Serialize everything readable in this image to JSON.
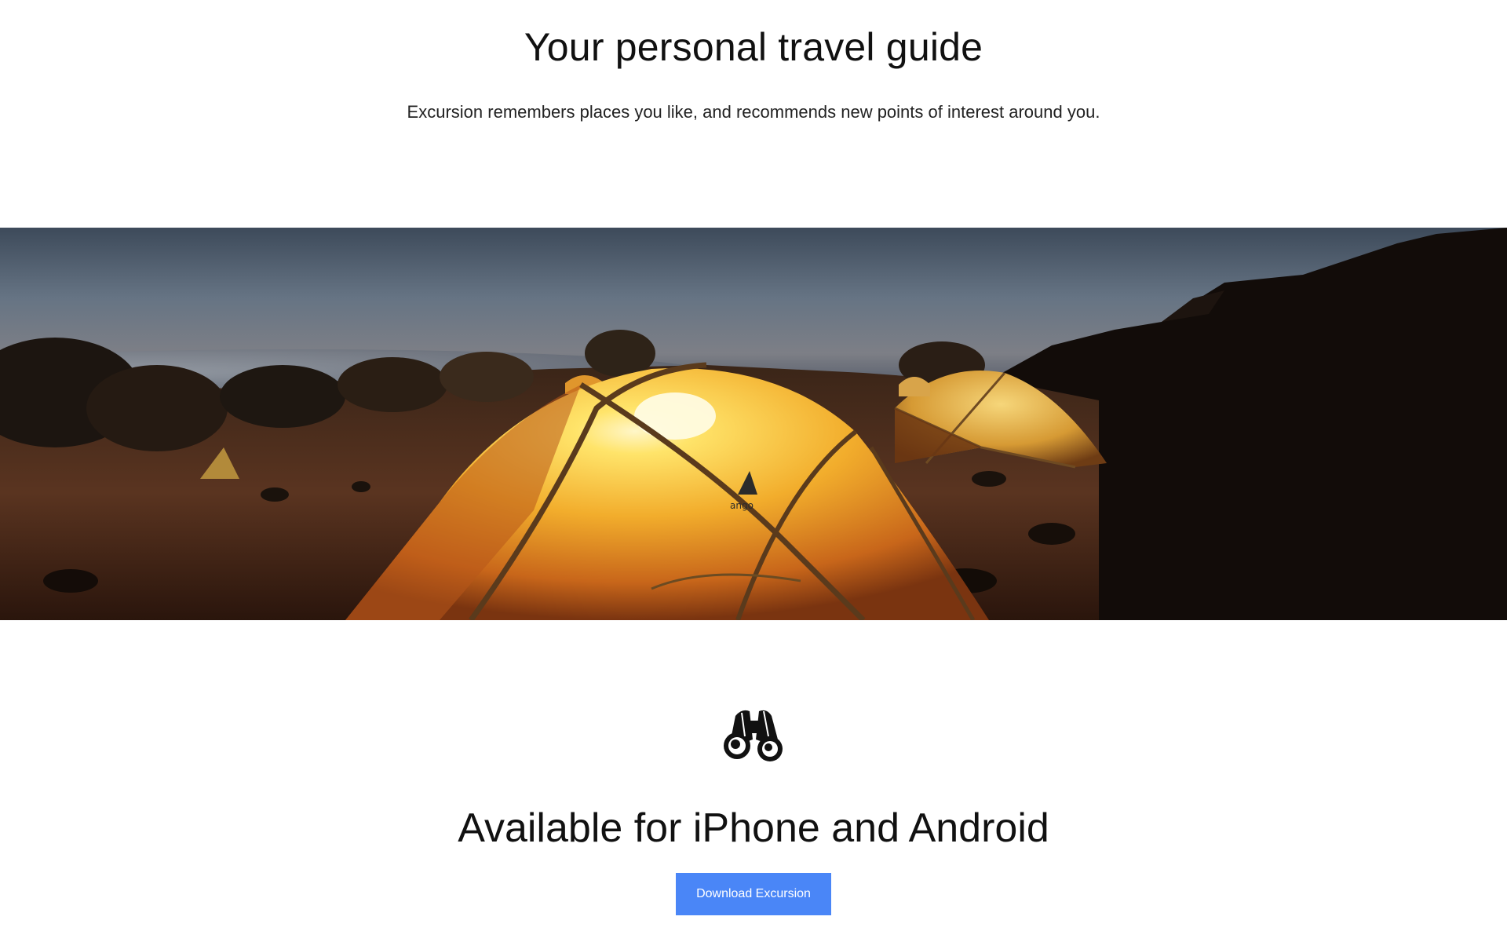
{
  "hero": {
    "title": "Your personal travel guide",
    "subtitle": "Excursion remembers places you like, and recommends new points of interest around you."
  },
  "banner": {
    "image_icon": "night-camping-tents-photo"
  },
  "feature": {
    "icon": "binoculars-icon"
  },
  "cta": {
    "title": "Available for iPhone and Android",
    "button_label": "Download Excursion",
    "button_color": "#4a86f7"
  }
}
